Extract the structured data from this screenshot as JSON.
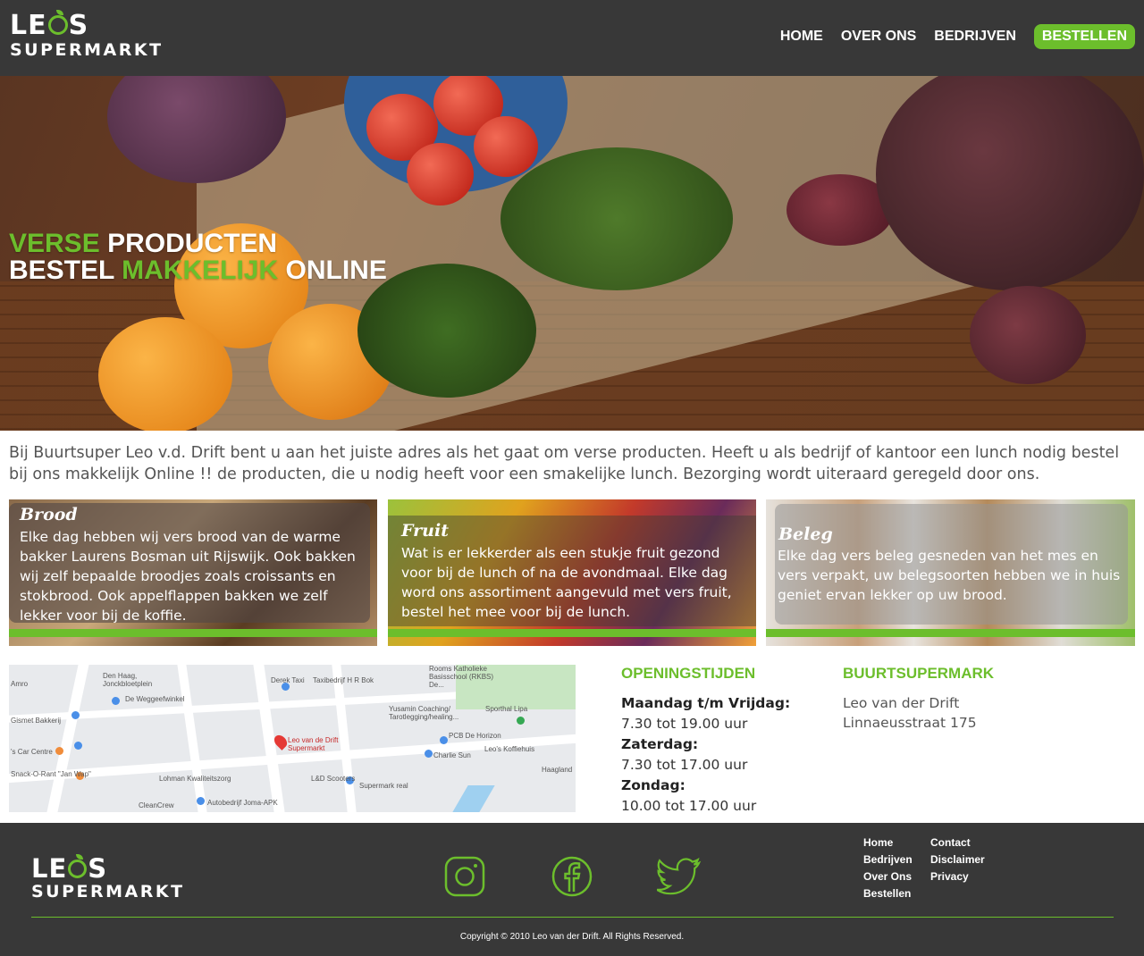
{
  "header": {
    "logo_line1_a": "LE",
    "logo_line1_b": "S",
    "logo_line2": "SUPERMARKT",
    "nav": {
      "home": "HOME",
      "about": "OVER ONS",
      "companies": "BEDRIJVEN",
      "order": "BESTELLEN"
    }
  },
  "hero": {
    "line1_green": "VERSE",
    "line1_white": "PRODUCTEN",
    "line2_white_a": "BESTEL",
    "line2_green": "MAKKELIJK",
    "line2_white_b": "ONLINE"
  },
  "intro": "Bij Buurtsuper Leo v.d. Drift bent u aan het juiste adres als het gaat om verse producten. Heeft u als bedrijf of kantoor een lunch nodig bestel bij ons makkelijk Online !! de producten, die u nodig heeft voor een smakelijke lunch. Bezorging wordt uiteraard geregeld door ons.",
  "cards": [
    {
      "title": "Brood",
      "text": "Elke dag hebben wij vers brood van de warme bakker Laurens Bosman uit Rijswijk. Ook bakken wij zelf bepaalde broodjes zoals croissants en stokbrood. Ook appelflappen bakken we zelf lekker voor bij de koffie."
    },
    {
      "title": "Fruit",
      "text": "Wat is er lekkerder als een stukje fruit gezond voor bij de lunch of na de avondmaal. Elke dag word ons assortiment aangevuld met vers fruit, bestel het mee voor bij de lunch."
    },
    {
      "title": "Beleg",
      "text": "Elke dag vers beleg gesneden van het mes en vers verpakt, uw belegsoorten hebben we in huis geniet ervan lekker op uw brood."
    }
  ],
  "map": {
    "labels": [
      "Amro",
      "Den Haag, Jonckbloetplein",
      "De Weggeefwinkel",
      "Derek Taxi",
      "Taxibedrijf H R Bok",
      "Rooms Katholieke Basisschool (RKBS) De...",
      "Gismet Bakkerij",
      "Yusamin Coaching/ Tarotlegging/healing...",
      "Sporthal Lipa",
      "PCB De Horizon",
      "Leo van de Drift Supermarkt",
      "Leo's Koffiehuis",
      "'s Car Centre",
      "Charlie Sun",
      "Snack-O-Rant \"Jan Wap\"",
      "Haagland",
      "Lohman Kwaliteitszorg",
      "L&D Scooters",
      "Supermark real",
      "CleanCrew",
      "Autobedrijf Joma-APK"
    ]
  },
  "hours": {
    "title": "OPENINGSTIJDEN",
    "rows": [
      {
        "day": "Maandag t/m Vrijdag:",
        "time": "7.30 tot 19.00 uur"
      },
      {
        "day": "Zaterdag:",
        "time": "7.30 tot 17.00 uur"
      },
      {
        "day": "Zondag:",
        "time": "10.00 tot 17.00 uur"
      }
    ]
  },
  "shop": {
    "title": "BUURTSUPERMARK",
    "name": "Leo van der Drift",
    "address": "Linnaeusstraat 175"
  },
  "footer": {
    "links_col1": [
      "Home",
      "Bedrijven",
      "Over Ons",
      "Bestellen"
    ],
    "links_col2": [
      "Contact",
      "Disclaimer",
      "Privacy"
    ],
    "copyright": "Copyright © 2010 Leo van der Drift. All Rights Reserved."
  },
  "colors": {
    "accent": "#6cbe2c",
    "dark": "#383838"
  }
}
